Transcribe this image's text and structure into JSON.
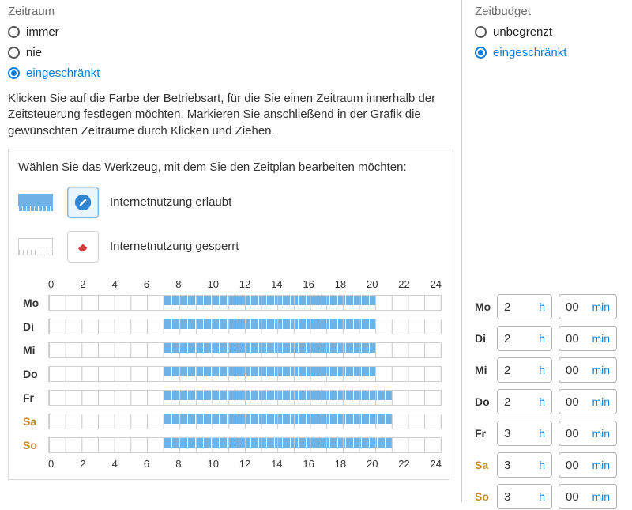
{
  "zeitraum": {
    "title": "Zeitraum",
    "opt_immer": "immer",
    "opt_nie": "nie",
    "opt_limit": "eingeschränkt",
    "selected": "limit"
  },
  "zeitbudget": {
    "title": "Zeitbudget",
    "opt_unlimit": "unbegrenzt",
    "opt_limit": "eingeschränkt",
    "selected": "limit"
  },
  "explain": "Klicken Sie auf die Farbe der Betriebsart, für die Sie einen Zeitraum innerhalb der Zeitsteuerung festlegen möchten. Markieren Sie anschließend in der Grafik die gewünschten Zeiträume durch Klicken und Ziehen.",
  "sched_intro": "Wählen Sie das Werkzeug, mit dem Sie den Zeitplan bearbeiten möchten:",
  "tool_allow": "Internetnutzung erlaubt",
  "tool_block": "Internetnutzung gesperrt",
  "active_tool": "allow",
  "axis": [
    "0",
    "2",
    "4",
    "6",
    "8",
    "10",
    "12",
    "14",
    "16",
    "18",
    "20",
    "22",
    "24"
  ],
  "days": [
    {
      "key": "Mo",
      "from": 7,
      "to": 20,
      "weekend": false
    },
    {
      "key": "Di",
      "from": 7,
      "to": 20,
      "weekend": false
    },
    {
      "key": "Mi",
      "from": 7,
      "to": 20,
      "weekend": false
    },
    {
      "key": "Do",
      "from": 7,
      "to": 20,
      "weekend": false
    },
    {
      "key": "Fr",
      "from": 7,
      "to": 21,
      "weekend": false
    },
    {
      "key": "Sa",
      "from": 7,
      "to": 21,
      "weekend": true
    },
    {
      "key": "So",
      "from": 7,
      "to": 21,
      "weekend": true
    }
  ],
  "budget_unit_h": "h",
  "budget_unit_min": "min",
  "budget": [
    {
      "key": "Mo",
      "h": "2",
      "min": "00",
      "weekend": false
    },
    {
      "key": "Di",
      "h": "2",
      "min": "00",
      "weekend": false
    },
    {
      "key": "Mi",
      "h": "2",
      "min": "00",
      "weekend": false
    },
    {
      "key": "Do",
      "h": "2",
      "min": "00",
      "weekend": false
    },
    {
      "key": "Fr",
      "h": "3",
      "min": "00",
      "weekend": false
    },
    {
      "key": "Sa",
      "h": "3",
      "min": "00",
      "weekend": true
    },
    {
      "key": "So",
      "h": "3",
      "min": "00",
      "weekend": true
    }
  ]
}
